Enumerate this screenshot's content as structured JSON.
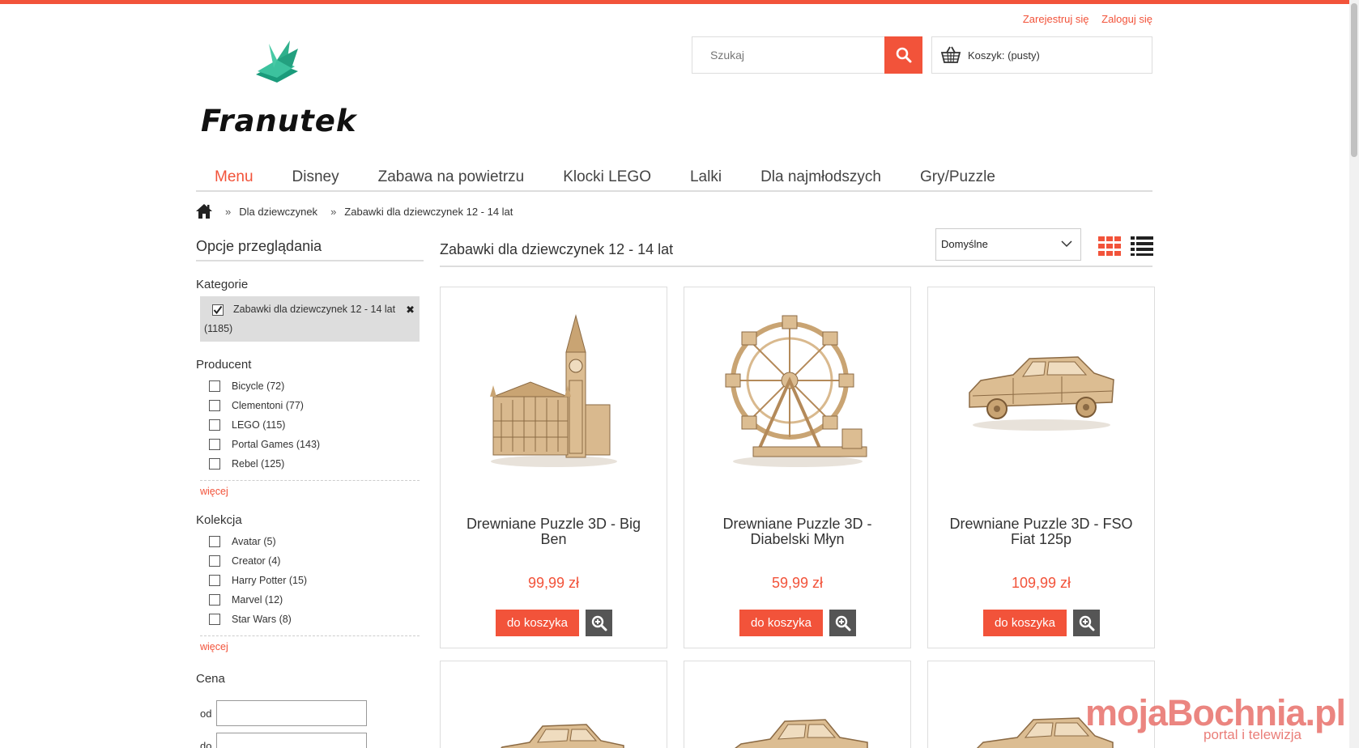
{
  "header": {
    "register_label": "Zarejestruj się",
    "login_label": "Zaloguj się",
    "logo_text": "Franutek",
    "search_placeholder": "Szukaj",
    "cart_label": "Koszyk: (pusty)"
  },
  "nav": {
    "items": [
      {
        "label": "Menu",
        "active": true
      },
      {
        "label": "Disney"
      },
      {
        "label": "Zabawa na powietrzu"
      },
      {
        "label": "Klocki LEGO"
      },
      {
        "label": "Lalki"
      },
      {
        "label": "Dla najmłodszych"
      },
      {
        "label": "Gry/Puzzle"
      }
    ]
  },
  "breadcrumb": {
    "separator": "»",
    "items": [
      "Dla dziewczynek",
      "Zabawki dla dziewczynek 12 - 14 lat"
    ]
  },
  "sidebar": {
    "title": "Opcje przeglądania",
    "category": {
      "title": "Kategorie",
      "selected": "Zabawki dla dziewczynek 12 - 14 lat",
      "selected_count": "(1185)",
      "remove_icon": "✖"
    },
    "producer": {
      "title": "Producent",
      "items": [
        "Bicycle (72)",
        "Clementoni (77)",
        "LEGO (115)",
        "Portal Games (143)",
        "Rebel (125)"
      ],
      "more": "więcej"
    },
    "collection": {
      "title": "Kolekcja",
      "items": [
        "Avatar (5)",
        "Creator (4)",
        "Harry Potter (15)",
        "Marvel (12)",
        "Star Wars (8)"
      ],
      "more": "więcej"
    },
    "price": {
      "title": "Cena",
      "from_label": "od",
      "to_label": "do"
    }
  },
  "content": {
    "title": "Zabawki dla dziewczynek 12 - 14 lat",
    "sort_value": "Domyślne"
  },
  "products": [
    {
      "name": "Drewniane Puzzle 3D - Big Ben",
      "price": "99,99 zł",
      "image": "big-ben-icon",
      "button": "do koszyka"
    },
    {
      "name": "Drewniane Puzzle 3D - Diabelski Młyn",
      "price": "59,99 zł",
      "image": "ferris-wheel-icon",
      "button": "do koszyka"
    },
    {
      "name": "Drewniane Puzzle 3D - FSO Fiat 125p",
      "price": "109,99 zł",
      "image": "car-icon",
      "button": "do koszyka"
    }
  ],
  "watermark": {
    "text": "mojaBochnia.pl",
    "subtext": "portal i telewizja"
  },
  "colors": {
    "accent": "#f2533a",
    "wood": "#d9b98e"
  }
}
